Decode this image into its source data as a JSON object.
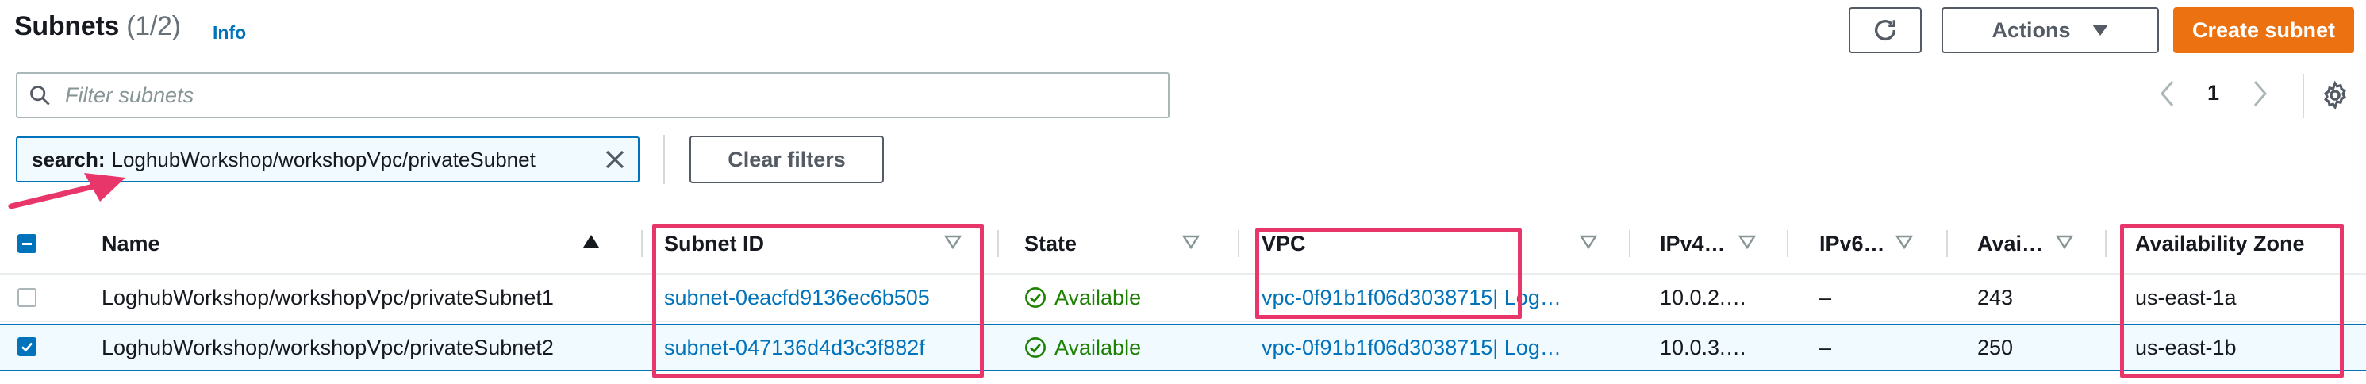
{
  "header": {
    "title": "Subnets",
    "count": "(1/2)",
    "info_link": "Info",
    "actions_label": "Actions",
    "create_label": "Create subnet"
  },
  "filter": {
    "placeholder": "Filter subnets",
    "value": ""
  },
  "pagination": {
    "current_page": "1"
  },
  "token": {
    "key": "search:",
    "value": "LoghubWorkshop/workshopVpc/privateSubnet"
  },
  "clear_filters_label": "Clear filters",
  "table": {
    "columns": {
      "name": "Name",
      "subnet_id": "Subnet ID",
      "state": "State",
      "vpc": "VPC",
      "ipv4": "IPv4…",
      "ipv6": "IPv6…",
      "avail_ips": "Avai…",
      "az": "Availability Zone"
    },
    "rows": [
      {
        "selected": false,
        "name": "LoghubWorkshop/workshopVpc/privateSubnet1",
        "subnet_id": "subnet-0eacfd9136ec6b505",
        "state": "Available",
        "vpc_id": "vpc-0f91b1f06d3038715",
        "vpc_suffix": " | Log…",
        "ipv4": "10.0.2.…",
        "ipv6": "–",
        "avail_ips": "243",
        "az": "us-east-1a"
      },
      {
        "selected": true,
        "name": "LoghubWorkshop/workshopVpc/privateSubnet2",
        "subnet_id": "subnet-047136d4d3c3f882f",
        "state": "Available",
        "vpc_id": "vpc-0f91b1f06d3038715",
        "vpc_suffix": " | Log…",
        "ipv4": "10.0.3.…",
        "ipv6": "–",
        "avail_ips": "250",
        "az": "us-east-1b"
      }
    ]
  },
  "colors": {
    "link": "#0073bb",
    "primary_button": "#ec7211",
    "status_green": "#1d8102",
    "annotation_pink": "#e8366b"
  }
}
